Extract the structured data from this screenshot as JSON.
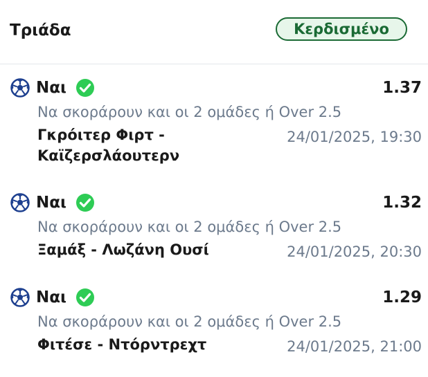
{
  "header": {
    "title": "Τριάδα",
    "status": "Κερδισμένο",
    "status_color": "#1a6a34",
    "status_bg": "#e7f6ea"
  },
  "bets": [
    {
      "sport_icon": "soccer-ball-icon",
      "selection": "Ναι",
      "result_icon": "check-circle-icon",
      "odds": "1.37",
      "market": "Να σκοράρουν και οι 2 ομάδες ή Over 2.5",
      "match_line1": "Γκρόιτερ Φιρτ -",
      "match_line2": "Καϊζερσλάουτερν",
      "datetime": "24/01/2025, 19:30"
    },
    {
      "sport_icon": "soccer-ball-icon",
      "selection": "Ναι",
      "result_icon": "check-circle-icon",
      "odds": "1.32",
      "market": "Να σκοράρουν και οι 2 ομάδες ή Over 2.5",
      "match_line1": "Ξαμάξ - Λωζάνη Ουσί",
      "datetime": "24/01/2025, 20:30"
    },
    {
      "sport_icon": "soccer-ball-icon",
      "selection": "Ναι",
      "result_icon": "check-circle-icon",
      "odds": "1.29",
      "market": "Να σκοράρουν και οι 2 ομάδες ή Over 2.5",
      "match_line1": "Φιτέσε - Ντόρντρεχτ",
      "datetime": "24/01/2025, 21:00"
    }
  ],
  "colors": {
    "check_green": "#2ecc55",
    "ball_blue": "#1d3f8f",
    "muted_text": "#6c7a8c"
  }
}
